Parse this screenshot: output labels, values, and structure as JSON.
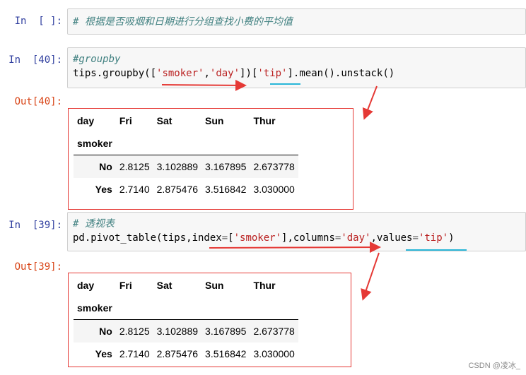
{
  "cells": [
    {
      "prompt": "In  [ ]:",
      "code_lines": [
        [
          {
            "t": "# 根据是否吸烟和日期进行分组查找小费的平均值",
            "c": "comment"
          }
        ]
      ]
    },
    {
      "prompt": "In  [40]:",
      "code_lines": [
        [
          {
            "t": "#groupby",
            "c": "comment"
          }
        ],
        [
          {
            "t": "tips.groupby([",
            "c": ""
          },
          {
            "t": "'smoker'",
            "c": "str"
          },
          {
            "t": ",",
            "c": ""
          },
          {
            "t": "'day'",
            "c": "str"
          },
          {
            "t": "])[",
            "c": ""
          },
          {
            "t": "'tip'",
            "c": "str"
          },
          {
            "t": "].mean().unstack()",
            "c": ""
          }
        ]
      ],
      "out_prompt": "Out[40]:"
    },
    {
      "prompt": "In  [39]:",
      "code_lines": [
        [
          {
            "t": "# 透视表",
            "c": "comment"
          }
        ],
        [
          {
            "t": "pd.pivot_table(tips,index",
            "c": ""
          },
          {
            "t": "=",
            "c": "op"
          },
          {
            "t": "[",
            "c": ""
          },
          {
            "t": "'smoker'",
            "c": "str"
          },
          {
            "t": "],columns",
            "c": ""
          },
          {
            "t": "=",
            "c": "op"
          },
          {
            "t": "'day'",
            "c": "str"
          },
          {
            "t": ",values",
            "c": ""
          },
          {
            "t": "=",
            "c": "op"
          },
          {
            "t": "'tip'",
            "c": "str"
          },
          {
            "t": ")",
            "c": ""
          }
        ]
      ],
      "out_prompt": "Out[39]:"
    }
  ],
  "dataframe": {
    "columns_name": "day",
    "columns": [
      "Fri",
      "Sat",
      "Sun",
      "Thur"
    ],
    "index_name": "smoker",
    "rows": [
      {
        "index": "No",
        "values": [
          "2.8125",
          "3.102889",
          "3.167895",
          "2.673778"
        ]
      },
      {
        "index": "Yes",
        "values": [
          "2.7140",
          "2.875476",
          "3.516842",
          "3.030000"
        ]
      }
    ]
  },
  "annotation_colors": {
    "box": "#e53935",
    "arrow": "#e53935",
    "underline": "#29b6d8"
  },
  "watermark": "CSDN @凌冰_"
}
